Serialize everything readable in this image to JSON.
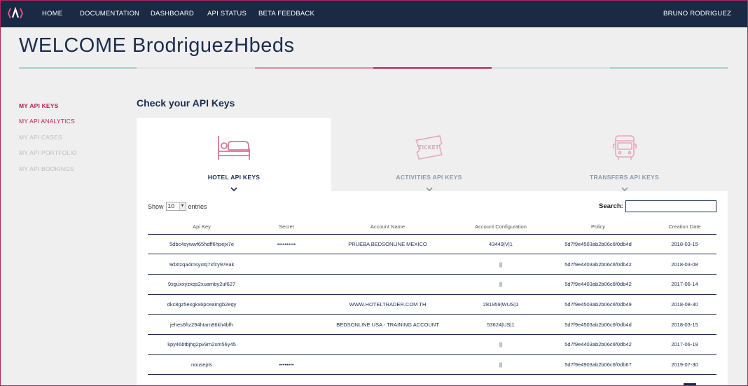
{
  "nav": {
    "items": [
      "HOME",
      "DOCUMENTATION",
      "DASHBOARD",
      "API STATUS",
      "BETA FEEDBACK"
    ],
    "user": "BRUNO RODRIGUEZ",
    "logo_icon": "brand-logo-icon"
  },
  "welcome": "WELCOME BrodriguezHbeds",
  "colors": {
    "navy": "#1a2a44",
    "accent": "#b2245a",
    "teal_line": "#a6cfcc",
    "pink_line": "#d98ea5"
  },
  "sidebar": {
    "items": [
      "MY API KEYS",
      "MY API ANALYTICS",
      "MY API CASES",
      "MY API PORTFOLIO",
      "MY API BOOKINGS"
    ]
  },
  "section_title": "Check your API Keys",
  "tabs": [
    {
      "label": "HOTEL API KEYS",
      "icon": "bed-icon",
      "active": true
    },
    {
      "label": "ACTIVITIES API KEYS",
      "icon": "ticket-icon",
      "ticket_text": "TICKET",
      "active": false
    },
    {
      "label": "TRANSFERS API KEYS",
      "icon": "bus-icon",
      "active": false
    }
  ],
  "table": {
    "show_label": "Show",
    "entries_value": "10",
    "entries_label": "entries",
    "search_label": "Search:",
    "search_value": "",
    "columns": [
      "Api Key",
      "Secret",
      "Account Name",
      "Account Configuration",
      "Policy",
      "Creation Date"
    ],
    "rows": [
      [
        "5dbc4sywwf65hdff6hpejx7e",
        "••••••••••",
        "PRUEBA BEDSONLINE MEXICO",
        "43449|V|1",
        "5d7f9e4503ab2b06c6f0db4d",
        "2018-03-15"
      ],
      [
        "9d3tzqa4msyxtq7xfcy97eak",
        "",
        "",
        "||",
        "5d7f9e4403ab2b06c6f0db42",
        "2018-03-08"
      ],
      [
        "9sguxxyzxqs2xuamby2uf627",
        "",
        "",
        "||",
        "5d7f9e4403ab2b06c6f0db42",
        "2017-06-14"
      ],
      [
        "dkc8gz5exgkx6pceamgb2eqy",
        "",
        "WWW.HOTELTRADER.COM TH",
        "281959|WUS|1",
        "5d7f9e4503ab2b06c6f0db49",
        "2018-08-30"
      ],
      [
        "jehes6ftz294htam86kh4bfh",
        "",
        "BEDSONLINE USA - TRAINING ACCOUNT",
        "53624|US|1",
        "5d7f9e4503ab2b06c6f0db4d",
        "2018-03-15"
      ],
      [
        "kpy46btbjhg2pv9m2xm56y45",
        "",
        "",
        "||",
        "5d7f9e4403ab2b06c6f0db42",
        "2017-06-19"
      ],
      [
        "nousepls",
        "••••••••",
        "",
        "||",
        "5d7f9e4903ab2b06c6f0db67",
        "2019-07-30"
      ]
    ]
  }
}
